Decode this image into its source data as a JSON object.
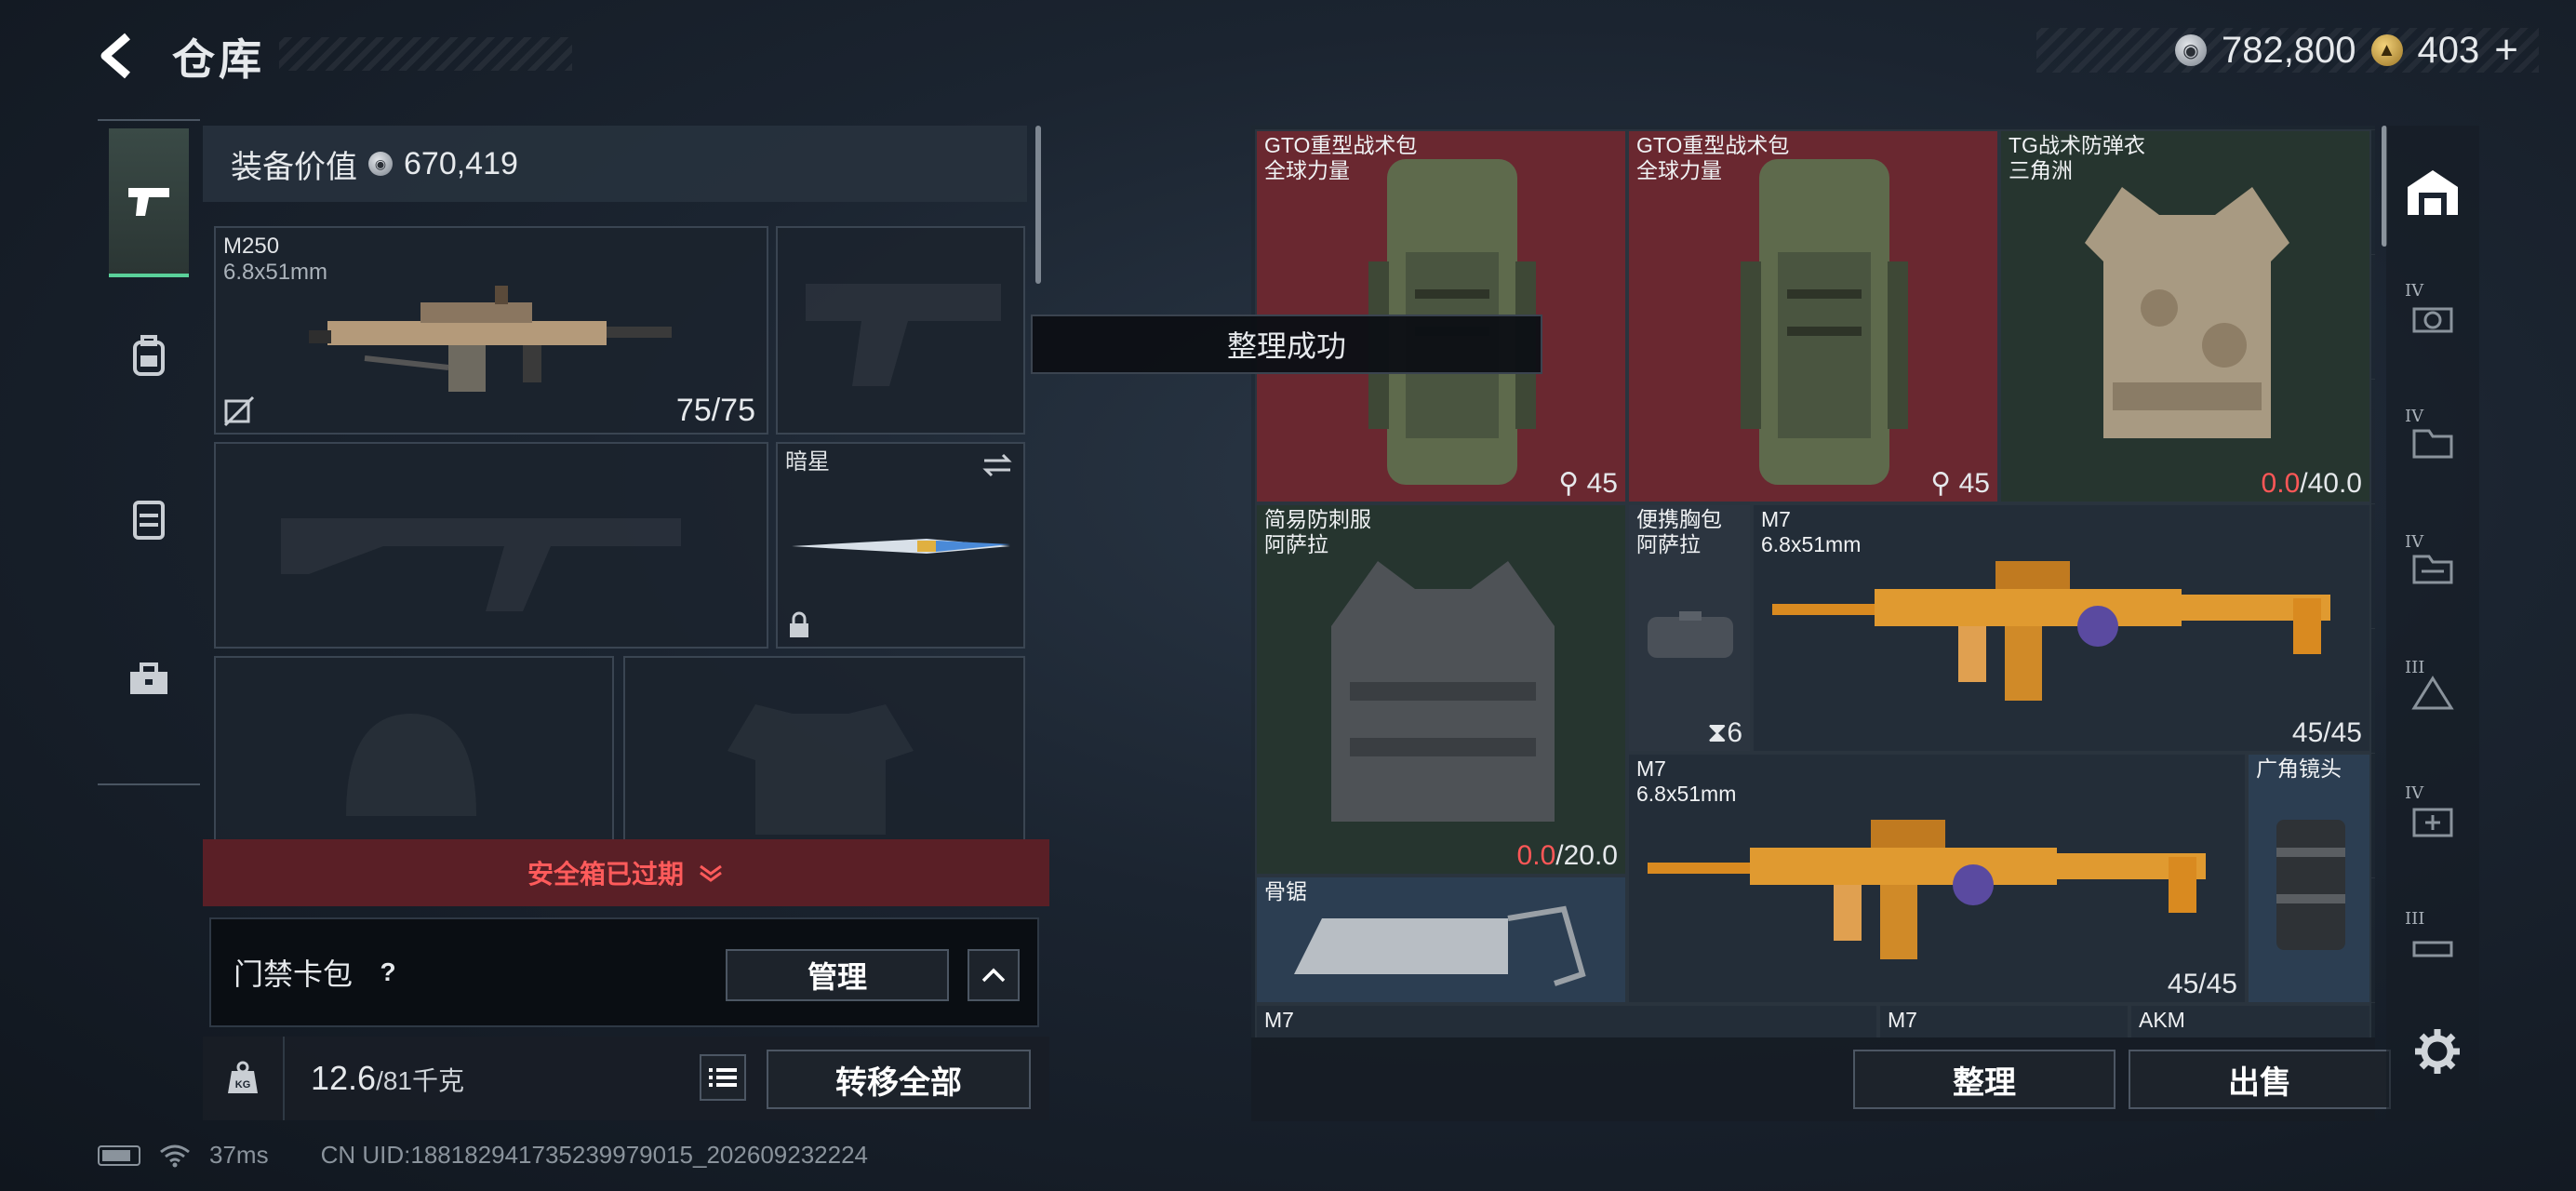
{
  "header": {
    "title": "仓库",
    "silver_amount": "782,800",
    "gold_amount": "403",
    "plus_label": "+"
  },
  "left_tabs": [
    "weapon-tab",
    "backpack-tab",
    "vest-tab",
    "toolbox-tab"
  ],
  "equipment": {
    "value_label": "装备价值",
    "value": "670,419",
    "primary": {
      "name": "M250",
      "caliber": "6.8x51mm",
      "ammo": "75/75"
    },
    "melee": {
      "name": "暗星"
    },
    "safe_box_label": "安全箱已过期",
    "card_pack_label": "门禁卡包",
    "help_label": "?",
    "manage_label": "管理",
    "weight_value": "12.6",
    "weight_max": "/81千克",
    "transfer_all_label": "转移全部"
  },
  "toast": {
    "message": "整理成功"
  },
  "stash": {
    "items": [
      {
        "name": "GTO重型战术包",
        "sub": "全球力量",
        "qty": "45"
      },
      {
        "name": "GTO重型战术包",
        "sub": "全球力量",
        "qty": "45"
      },
      {
        "name": "TG战术防弹衣",
        "sub": "三角洲",
        "dur_cur": "0.0",
        "dur_max": "/40.0"
      },
      {
        "name": "简易防刺服",
        "sub": "阿萨拉",
        "dur_cur": "0.0",
        "dur_max": "/20.0"
      },
      {
        "name": "便携胸包",
        "sub": "阿萨拉",
        "qty": "6"
      },
      {
        "name": "M7",
        "sub": "6.8x51mm",
        "qty": "45/45"
      },
      {
        "name": "M7",
        "sub": "6.8x51mm",
        "qty": "45/45"
      },
      {
        "name": "广角镜头"
      },
      {
        "name": "骨锯"
      },
      {
        "name": "M7"
      },
      {
        "name": "M7"
      },
      {
        "name": "AKM"
      }
    ],
    "sort_label": "整理",
    "sell_label": "出售"
  },
  "right_tabs": [
    {
      "level": ""
    },
    {
      "level": "IV"
    },
    {
      "level": "IV"
    },
    {
      "level": "IV"
    },
    {
      "level": "III"
    },
    {
      "level": "IV"
    },
    {
      "level": "III"
    }
  ],
  "status": {
    "ping": "37ms",
    "uid": "CN UID:18818294173523997901­5_202609232224"
  },
  "colors": {
    "accent_green": "#5ad19a",
    "warning_red": "#ff5757",
    "rare_red_bg": "#6a2830",
    "green_bg": "#26352f"
  }
}
